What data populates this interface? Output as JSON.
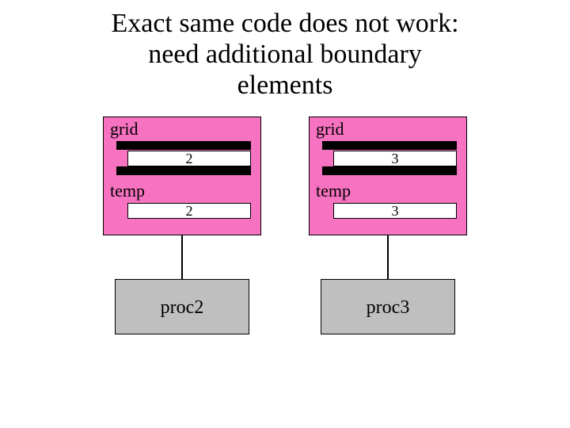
{
  "title": {
    "line1": "Exact same code does not work:",
    "line2": "need additional boundary",
    "line3": "elements"
  },
  "columns": [
    {
      "grid_label": "grid",
      "grid_value": "2",
      "temp_label": "temp",
      "temp_value": "2",
      "proc_label": "proc2"
    },
    {
      "grid_label": "grid",
      "grid_value": "3",
      "temp_label": "temp",
      "temp_value": "3",
      "proc_label": "proc3"
    }
  ],
  "colors": {
    "box_fill": "#f772c0",
    "proc_fill": "#bfbfbf"
  }
}
